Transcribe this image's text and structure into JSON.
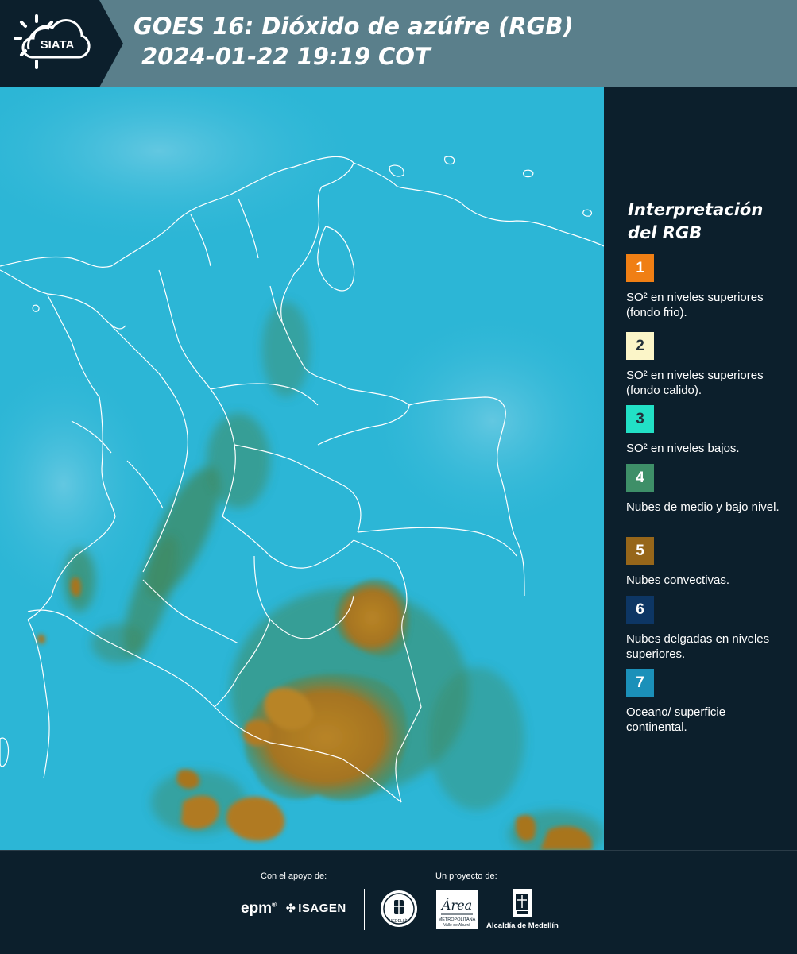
{
  "header": {
    "logo_text": "SIATA",
    "title_line1": "GOES 16: Dióxido de azúfre (RGB)",
    "title_line2": "2024-01-22 19:19 COT",
    "bg_color": "#5a7f8b"
  },
  "map": {
    "background_color": "#2fb8d8",
    "border_color": "#ffffff",
    "convective_cloud_color": "#b07a23",
    "low_cloud_color": "#3f8f6a"
  },
  "legend": {
    "title": "Interpretación del RGB",
    "items": [
      {
        "number": "1",
        "color": "#f07f14",
        "text": "SO² en niveles superiores (fondo frio)."
      },
      {
        "number": "2",
        "color": "#fbf5c8",
        "text": "SO² en niveles superiores (fondo calido)."
      },
      {
        "number": "3",
        "color": "#22e0c6",
        "text": "SO² en niveles bajos."
      },
      {
        "number": "4",
        "color": "#3e8f68",
        "text": "Nubes de medio y bajo nivel."
      },
      {
        "number": "5",
        "color": "#96661a",
        "text": "Nubes convectivas."
      },
      {
        "number": "6",
        "color": "#0d3664",
        "text": "Nubes delgadas en niveles superiores."
      },
      {
        "number": "7",
        "color": "#1b90b9",
        "text": "Oceano/ superficie continental."
      }
    ]
  },
  "footer": {
    "support_label": "Con el apoyo de:",
    "project_label": "Un proyecto de:",
    "sponsor1": "epm",
    "sponsor2": "ISAGEN",
    "partner_area": "Área",
    "partner_area_sub": "METROPOLITANA",
    "partner_area_sub2": "Valle de Aburrá",
    "partner_alcaldia": "Alcaldía de Medellín",
    "seal_text": "MEDELLÍN"
  }
}
